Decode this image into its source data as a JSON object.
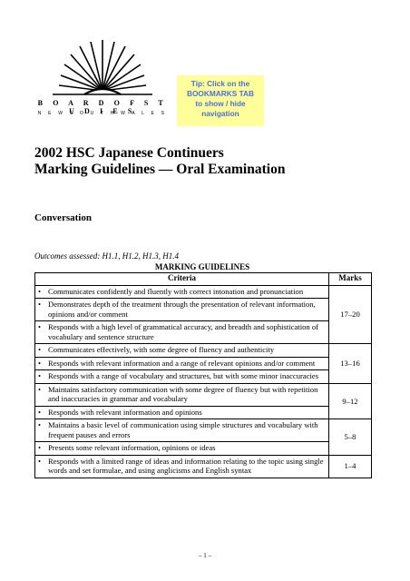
{
  "header": {
    "org_name": "B O A R D  O F  S T U D I E S",
    "org_sub": "N E W  S O U T H  W A L E S",
    "tip_lines": [
      "Tip: Click on the",
      "BOOKMARKS TAB",
      "to show / hide",
      "navigation"
    ]
  },
  "title_lines": [
    "2002 HSC Japanese Continuers",
    "Marking Guidelines — Oral Examination"
  ],
  "section_title": "Conversation",
  "outcomes": "Outcomes assessed: H1.1, H1.2, H1.3, H1.4",
  "table": {
    "heading": "MARKING GUIDELINES",
    "col_criteria": "Criteria",
    "col_marks": "Marks",
    "bullet": "•",
    "rows": [
      {
        "marks": "17–20",
        "items": [
          "Communicates confidently and fluently with correct intonation and pronunciation",
          "Demonstrates depth of the treatment through the presentation of relevant information, opinions and/or comment",
          "Responds with a high level of grammatical accuracy, and breadth and sophistication of vocabulary and sentence structure"
        ]
      },
      {
        "marks": "13–16",
        "items": [
          "Communicates effectively, with some degree of fluency and authenticity",
          "Responds with relevant information and a range of relevant opinions and/or comment",
          "Responds with a range of vocabulary and structures, but with some minor inaccuracies"
        ]
      },
      {
        "marks": "9–12",
        "items": [
          "Maintains satisfactory communication with some degree of fluency but with repetition and inaccuracies in grammar and vocabulary",
          "Responds with relevant information and opinions"
        ]
      },
      {
        "marks": "5–8",
        "items": [
          "Maintains a basic level of communication using simple structures and vocabulary with frequent pauses and errors",
          "Presents some relevant information, opinions or ideas"
        ]
      },
      {
        "marks": "1–4",
        "items": [
          "Responds with a limited range of ideas and information relating to the topic using single words and set formulae, and using anglicisms and English syntax"
        ]
      }
    ]
  },
  "footer": {
    "page": "– 1 –"
  }
}
